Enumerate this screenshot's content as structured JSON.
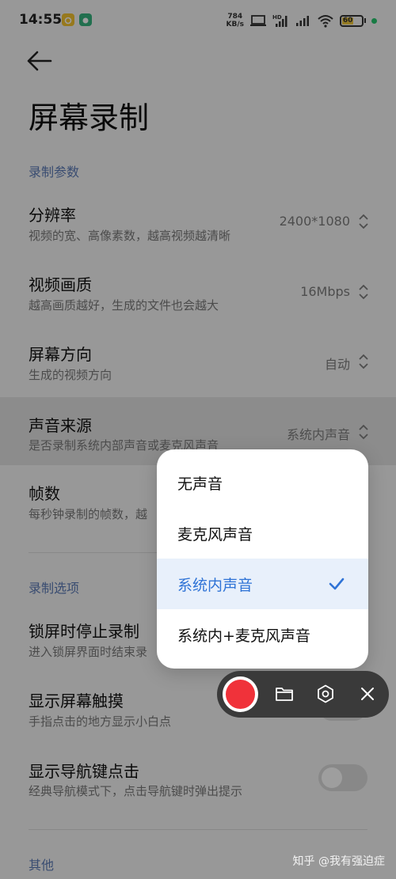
{
  "status_bar": {
    "time": "14:55",
    "net_speed_value": "784",
    "net_speed_unit": "KB/s",
    "battery_level": "60",
    "icons": [
      "camera-app-icon",
      "android-app-icon",
      "laptop-icon",
      "hd-signal-icon",
      "signal-icon",
      "wifi-icon",
      "battery-icon"
    ]
  },
  "header": {
    "back_icon": "arrow-left-icon",
    "title": "屏幕录制"
  },
  "section_record_params": {
    "heading": "录制参数",
    "rows": [
      {
        "title": "分辨率",
        "subtitle": "视频的宽、高像素数，越高视频越清晰",
        "value": "2400*1080"
      },
      {
        "title": "视频画质",
        "subtitle": "越高画质越好，生成的文件也会越大",
        "value": "16Mbps"
      },
      {
        "title": "屏幕方向",
        "subtitle": "生成的视频方向",
        "value": "自动"
      },
      {
        "title": "声音来源",
        "subtitle": "是否录制系统内部声音或麦克风声音",
        "value": "系统内声音"
      },
      {
        "title": "帧数",
        "subtitle": "每秒钟录制的帧数，越"
      }
    ]
  },
  "section_record_options": {
    "heading": "录制选项",
    "rows": [
      {
        "title": "锁屏时停止录制",
        "subtitle": "进入锁屏界面时结束录"
      },
      {
        "title": "显示屏幕触摸",
        "subtitle": "手指点击的地方显示小白点"
      },
      {
        "title": "显示导航键点击",
        "subtitle": "经典导航模式下，点击导航键时弹出提示",
        "toggle_on": false
      }
    ]
  },
  "section_other": {
    "heading": "其他"
  },
  "sound_source_menu": {
    "options": [
      "无声音",
      "麦克风声音",
      "系统内声音",
      "系统内+麦克风声音"
    ],
    "selected_index": 2
  },
  "floating_toolbar": {
    "icons": [
      "record-icon",
      "folder-icon",
      "settings-icon",
      "close-icon"
    ]
  },
  "watermark": "知乎 @我有强迫症",
  "colors": {
    "accent": "#2f73d6",
    "record": "#f0323a",
    "section_heading": "#5c7bb6",
    "toolbar_bg": "#3a3a3a"
  }
}
